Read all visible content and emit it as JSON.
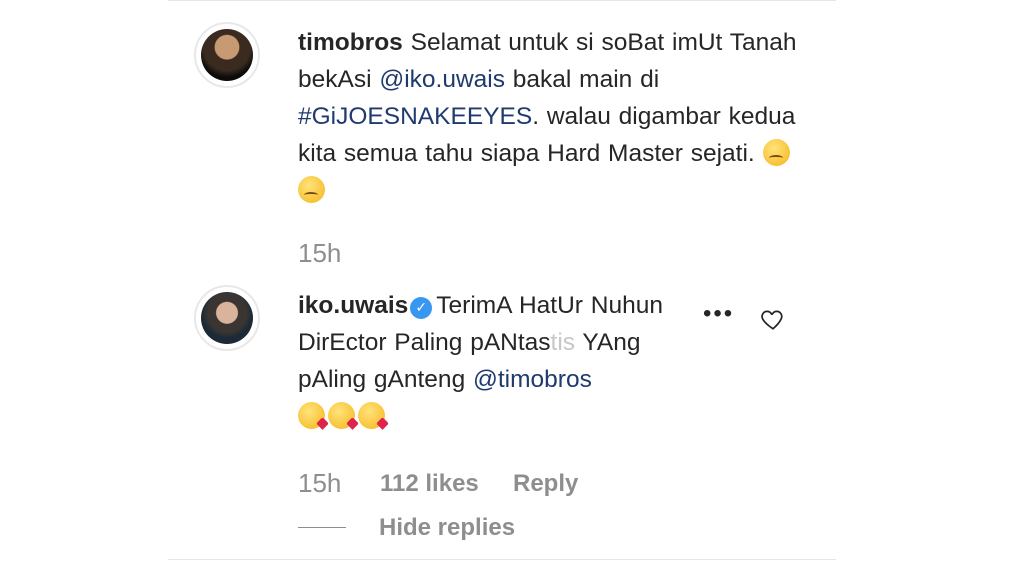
{
  "comment1": {
    "username": "timobros",
    "segments": {
      "a": "Selamat untuk si soBat imUt Tanah bekAsi ",
      "mention": "@iko.uwais",
      "b": " bakal main di ",
      "hashtag": "#GiJOESNAKEEYES",
      "c": ". walau digambar kedua kita semua tahu siapa Hard Master sejati."
    },
    "emoji": [
      "woozy-face",
      "woozy-face"
    ],
    "time": "15h"
  },
  "comment2": {
    "username": "iko.uwais",
    "verified": true,
    "segments": {
      "a": "TerimA HatUr Nuhun DirEctor Paling pANtas",
      "faded": "tis",
      "b": " YAng pAling gAnteng ",
      "mention": "@timobros"
    },
    "emoji": [
      "kissing-face",
      "kissing-face",
      "kissing-face"
    ],
    "time": "15h",
    "likes": "112 likes",
    "reply_label": "Reply",
    "more_label": "•••",
    "hide_replies_label": "Hide replies"
  },
  "colors": {
    "text": "#262626",
    "muted": "#8e8e8e",
    "link": "#1e3a6e",
    "verified": "#3897f0"
  }
}
